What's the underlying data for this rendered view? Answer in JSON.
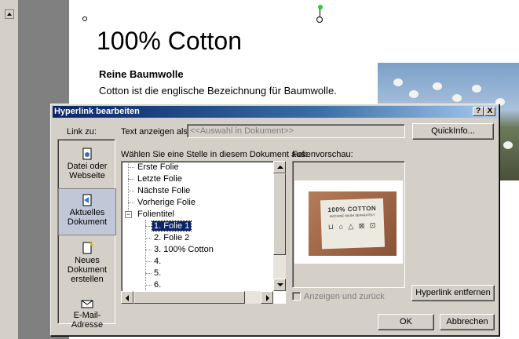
{
  "slide": {
    "title": "100% Cotton",
    "subtitle": "Reine Baumwolle",
    "body": "Cotton ist die englische Bezeichnung für Baumwolle."
  },
  "dialog": {
    "title": "Hyperlink bearbeiten",
    "help_btn": "?",
    "close_btn": "X",
    "link_to_label": "Link zu:",
    "display_text_label": "Text anzeigen als:",
    "display_text_value": "<<Auswahl in Dokument>>",
    "quickinfo_btn": "QuickInfo...",
    "place_label": "Wählen Sie eine Stelle in diesem Dokument aus:",
    "preview_label": "Folienvorschau:",
    "link_items": [
      {
        "label": "Datei oder Webseite",
        "icon": "web-file-icon"
      },
      {
        "label": "Aktuelles Dokument",
        "icon": "document-icon"
      },
      {
        "label": "Neues Dokument erstellen",
        "icon": "new-document-icon"
      },
      {
        "label": "E-Mail-Adresse",
        "icon": "email-icon"
      }
    ],
    "tree": {
      "items": [
        "Erste Folie",
        "Letzte Folie",
        "Nächste Folie",
        "Vorherige Folie"
      ],
      "group": "Folientitel",
      "slides": [
        "1. Folie 1",
        "2. Folie 2",
        "3. 100% Cotton",
        "4.",
        "5.",
        "6."
      ],
      "selected_index": 0
    },
    "preview_text_1": "100% COTTON",
    "preview_text_2": "MACHINE WASH SEPARATELY",
    "show_and_return_label": "Anzeigen und zurück",
    "remove_link_btn": "Hyperlink entfernen",
    "ok_btn": "OK",
    "cancel_btn": "Abbrechen"
  },
  "colors": {
    "titlebar_start": "#0a246a",
    "selection": "#0a246a",
    "dialog_bg": "#d4d0c8"
  }
}
